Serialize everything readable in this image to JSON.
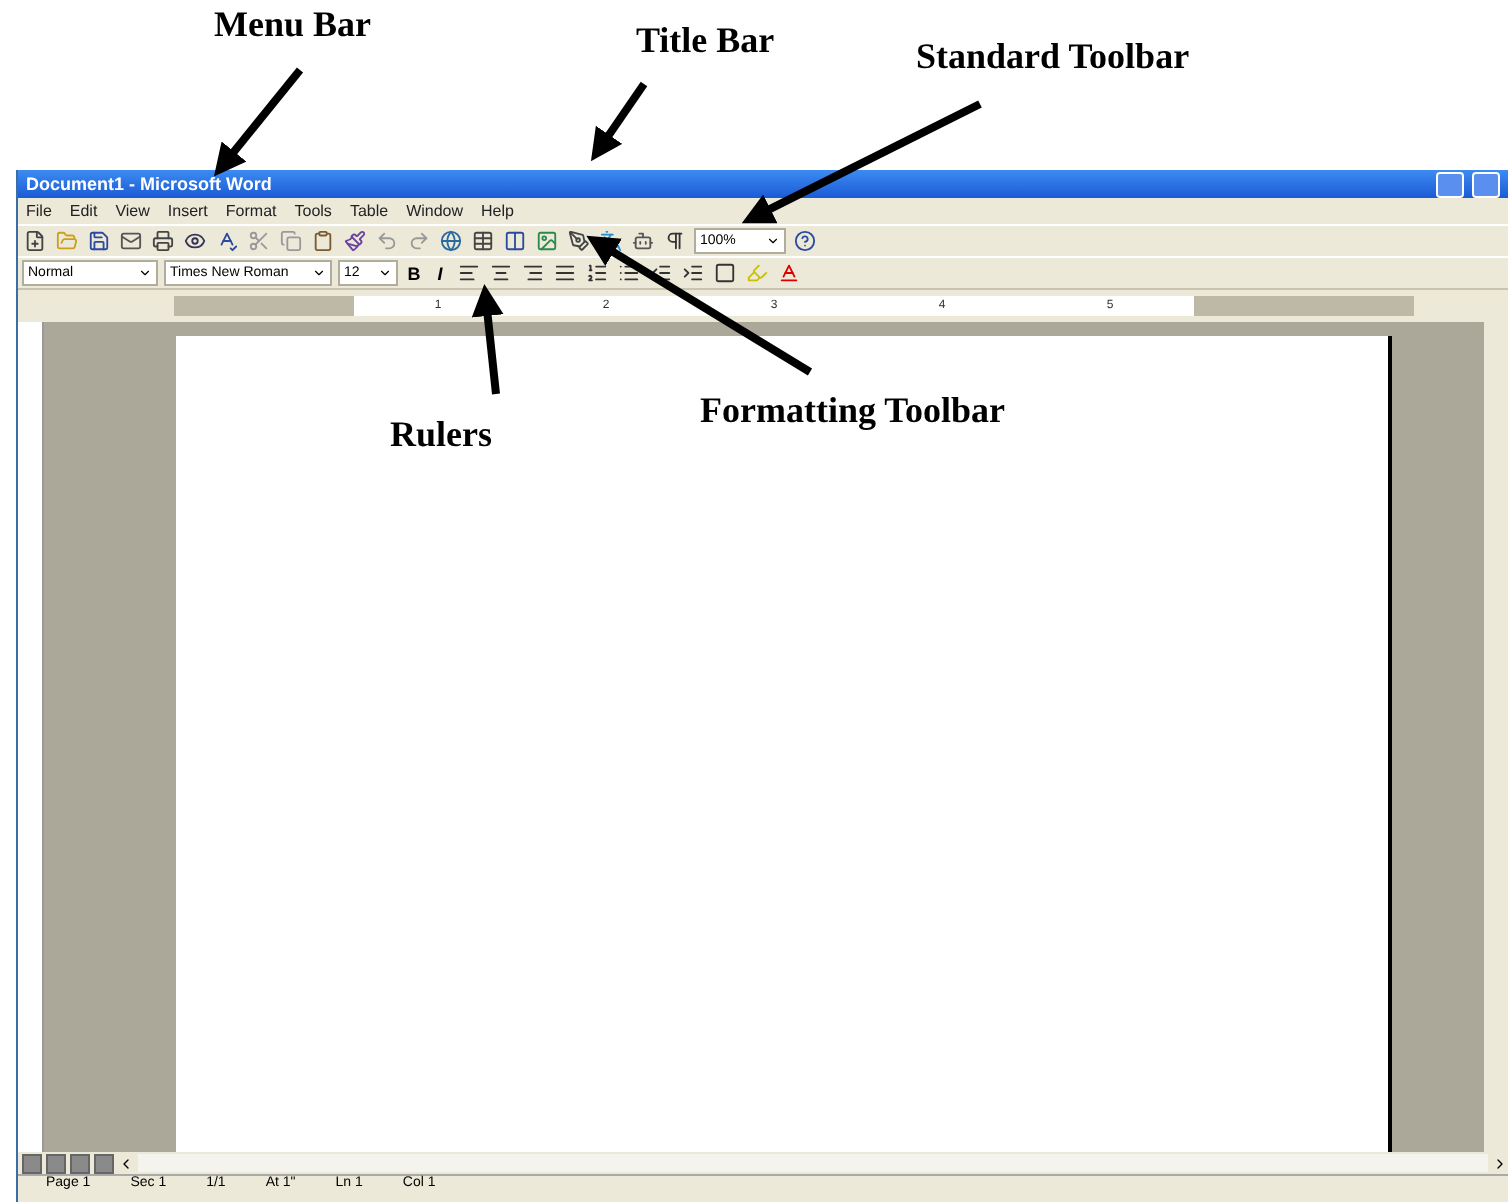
{
  "annotations": [
    {
      "label": "Menu Bar"
    },
    {
      "label": "Title Bar"
    },
    {
      "label": "Standard Toolbar"
    },
    {
      "label": "Formatting Toolbar"
    },
    {
      "label": "Rulers"
    }
  ],
  "window": {
    "title": "Document1 - Microsoft Word"
  },
  "menus": [
    "File",
    "Edit",
    "View",
    "Insert",
    "Format",
    "Tools",
    "Table",
    "Window",
    "Help"
  ],
  "standard_toolbar": {
    "zoom": "100%"
  },
  "formatting_toolbar": {
    "style": "Normal",
    "font": "Times New Roman",
    "size": "12",
    "bold": "B",
    "italic": "I"
  },
  "ruler": {
    "numbers": [
      "1",
      "2",
      "3",
      "4",
      "5"
    ]
  },
  "status_bar": [
    "Page 1",
    "Sec 1",
    "1/1",
    "At 1\"",
    "Ln 1",
    "Col 1"
  ]
}
